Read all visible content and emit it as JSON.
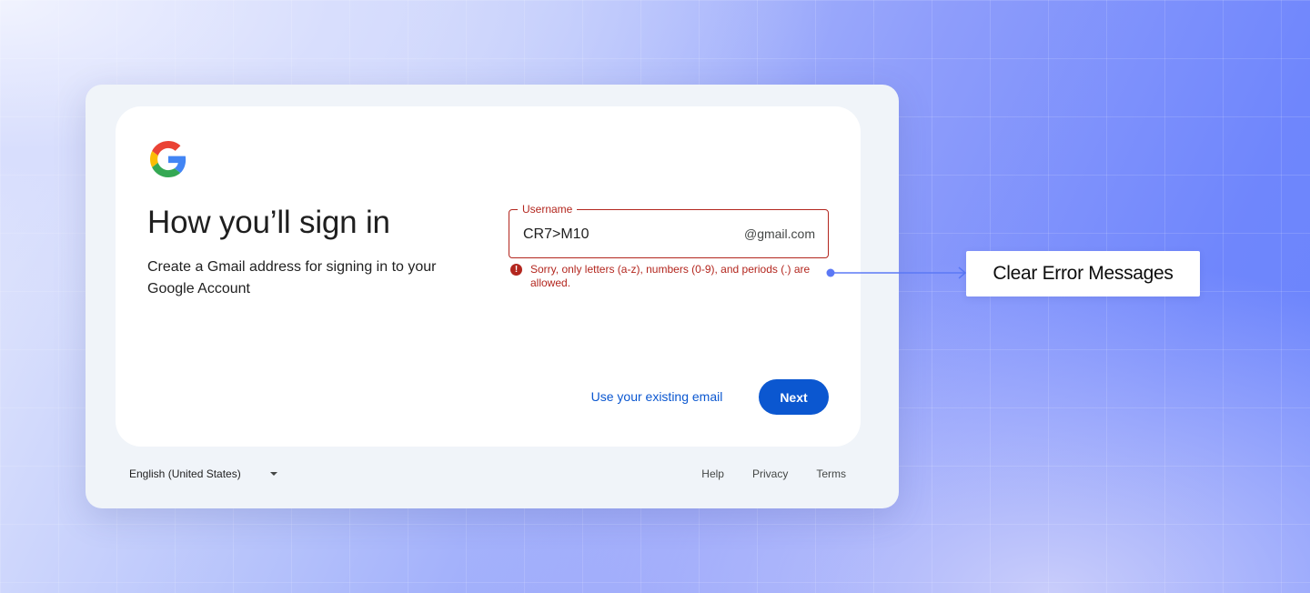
{
  "card": {
    "title": "How you’ll sign in",
    "subtitle": "Create a Gmail address for signing in to your Google Account",
    "username_field": {
      "label": "Username",
      "value": "CR7>M10",
      "suffix": "@gmail.com"
    },
    "error_message": "Sorry, only letters (a-z), numbers (0-9), and periods (.) are allowed.",
    "secondary_action": "Use your existing email",
    "primary_action": "Next"
  },
  "footer": {
    "language": "English (United States)",
    "links": [
      "Help",
      "Privacy",
      "Terms"
    ]
  },
  "callout": {
    "text": "Clear Error Messages"
  },
  "colors": {
    "primary": "#0b57d0",
    "error": "#b3261e",
    "connector": "#5b78f5"
  },
  "icons": {
    "logo": "google-g-icon",
    "error": "error-alert-icon",
    "dropdown": "caret-down-icon"
  }
}
